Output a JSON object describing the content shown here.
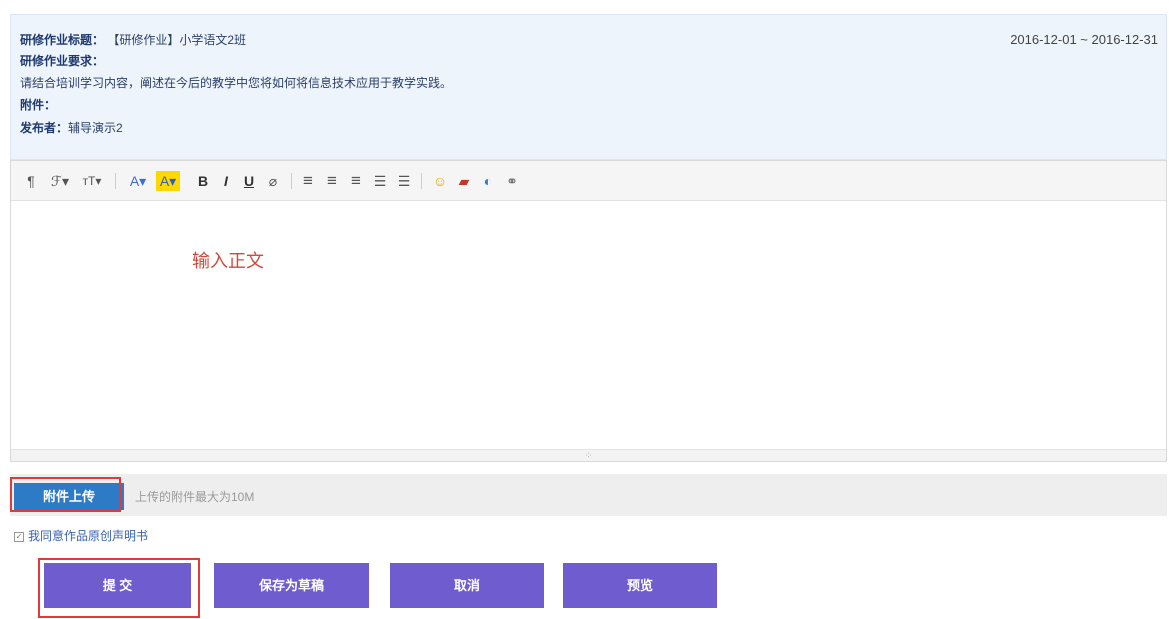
{
  "assignment": {
    "title_label": "研修作业标题：",
    "title_value": "【研修作业】小学语文2班",
    "date_range": "2016-12-01 ~ 2016-12-31",
    "requirement_label": "研修作业要求：",
    "requirement_text": "请结合培训学习内容，阐述在今后的教学中您将如何将信息技术应用于教学实践。",
    "attachment_label": "附件：",
    "publisher_label": "发布者：",
    "publisher_value": "辅导演示2"
  },
  "toolbar": {
    "icons": [
      "paragraph-icon",
      "font-family-icon",
      "font-size-icon",
      "font-color-icon",
      "highlight-color-icon",
      "bold-icon",
      "italic-icon",
      "underline-icon",
      "clear-format-icon",
      "align-left-icon",
      "align-center-icon",
      "align-right-icon",
      "ordered-list-icon",
      "unordered-list-icon",
      "emoticon-icon",
      "image-icon",
      "media-icon",
      "link-icon"
    ],
    "glyphs": {
      "paragraph": "¶",
      "font_family": "ℱ▾",
      "font_size": "тT▾",
      "font_color": "A▾",
      "highlight": "A▾",
      "bold": "B",
      "italic": "I",
      "underline": "U",
      "clear": "⌀",
      "align_left": "≡",
      "align_center": "≡",
      "align_right": "≡",
      "ordered_list": "☰",
      "unordered_list": "☰",
      "emoticon": "☺",
      "image": "▰",
      "media": "◐",
      "link": "⚭"
    }
  },
  "editor": {
    "body_text": "输入正文",
    "resize_handle": "⁘"
  },
  "upload": {
    "button_label": "附件上传",
    "hint": "上传的附件最大为10M"
  },
  "agreement": {
    "checkbox_mark": "✓",
    "label": "我同意作品原创声明书"
  },
  "actions": {
    "submit": "提 交",
    "save_draft": "保存为草稿",
    "cancel": "取消",
    "preview": "预览"
  },
  "colors": {
    "info_bg": "#eef4fc",
    "upload_button": "#2d7ac7",
    "action_button": "#6f5ccf",
    "highlight_border": "#e23a3a",
    "body_text": "#d04a3c"
  }
}
